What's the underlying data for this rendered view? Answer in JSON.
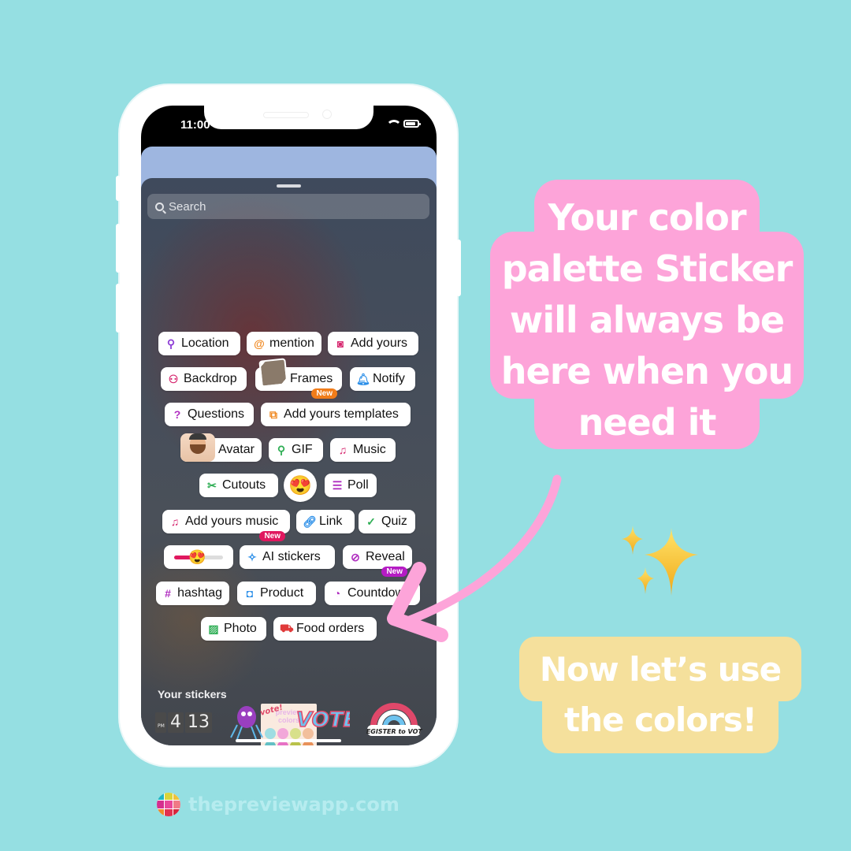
{
  "status_bar": {
    "time": "11:00"
  },
  "sticker_sheet": {
    "search": {
      "placeholder": "Search",
      "value": ""
    },
    "chips": [
      {
        "id": "location",
        "label": "Location",
        "icon": "location-pin-icon",
        "glyph": "⚲",
        "icon_color": "#8e3fd6"
      },
      {
        "id": "mention",
        "label": "mention",
        "icon": "threads-at-icon",
        "glyph": "@",
        "icon_color": "#f08a24"
      },
      {
        "id": "add-yours",
        "label": "Add yours",
        "icon": "camera-icon",
        "glyph": "◙",
        "icon_color": "#d6266e"
      },
      {
        "id": "backdrop",
        "label": "Backdrop",
        "icon": "backdrop-person-icon",
        "glyph": "⚇",
        "icon_color": "#d6266e"
      },
      {
        "id": "frames",
        "label": "Frames",
        "icon": "photo-frame-thumbnail",
        "badge": "New",
        "badge_color": "#f07c1a"
      },
      {
        "id": "notify",
        "label": "Notify",
        "icon": "bell-icon",
        "glyph": "🔔︎",
        "icon_color": "#2a8ee8"
      },
      {
        "id": "questions",
        "label": "Questions",
        "icon": "question-bubble-icon",
        "glyph": "?",
        "icon_color": "#b02fc0"
      },
      {
        "id": "add-yours-templates",
        "label": "Add yours templates",
        "icon": "add-layers-icon",
        "glyph": "⧉",
        "icon_color": "#f08a24"
      },
      {
        "id": "avatar",
        "label": "Avatar",
        "icon": "avatar-thumbnail"
      },
      {
        "id": "gif",
        "label": "GIF",
        "icon": "search-icon",
        "glyph": "⚲",
        "icon_color": "#2fae55"
      },
      {
        "id": "music",
        "label": "Music",
        "icon": "music-note-icon",
        "glyph": "♫",
        "icon_color": "#d6266e"
      },
      {
        "id": "cutouts",
        "label": "Cutouts",
        "icon": "scissors-icon",
        "glyph": "✂",
        "icon_color": "#2fae55"
      },
      {
        "id": "emoji",
        "label": "",
        "icon": "heart-eyes-emoji",
        "glyph": "😍"
      },
      {
        "id": "poll",
        "label": "Poll",
        "icon": "poll-bars-icon",
        "glyph": "☰",
        "icon_color": "#b02fc0"
      },
      {
        "id": "add-yours-music",
        "label": "Add yours music",
        "icon": "music-plus-icon",
        "glyph": "♫",
        "icon_color": "#d6266e",
        "badge": "New",
        "badge_color": "#e0185f"
      },
      {
        "id": "link",
        "label": "Link",
        "icon": "link-icon",
        "glyph": "🔗︎",
        "icon_color": "#2a8ee8"
      },
      {
        "id": "quiz",
        "label": "Quiz",
        "icon": "check-circle-icon",
        "glyph": "✓",
        "icon_color": "#2fae55"
      },
      {
        "id": "emoji-slider",
        "label": "",
        "icon": "emoji-slider",
        "glyph": "😍",
        "slider_value": 0.45
      },
      {
        "id": "ai-stickers",
        "label": "AI stickers",
        "icon": "sparkle-shapes-icon",
        "glyph": "✧",
        "icon_color": "#2a8ee8"
      },
      {
        "id": "reveal",
        "label": "Reveal",
        "icon": "eye-off-icon",
        "glyph": "⊘",
        "icon_color": "#b02fc0",
        "badge": "New",
        "badge_color": "#b51bc4"
      },
      {
        "id": "hashtag",
        "label": "hashtag",
        "icon": "hashtag-icon",
        "glyph": "#",
        "icon_color": "#b02fc0"
      },
      {
        "id": "product",
        "label": "Product",
        "icon": "shopping-bag-icon",
        "glyph": "◘",
        "icon_color": "#2a8ee8"
      },
      {
        "id": "countdown",
        "label": "Countdown",
        "icon": "countdown-timer-icon",
        "glyph": "◔",
        "icon_color": "#b02fc0"
      },
      {
        "id": "photo",
        "label": "Photo",
        "icon": "image-icon",
        "glyph": "▨",
        "icon_color": "#2fae55"
      },
      {
        "id": "food-orders",
        "label": "Food orders",
        "icon": "delivery-truck-icon",
        "glyph": "⛟",
        "icon_color": "#e03a3a"
      }
    ],
    "your_stickers": {
      "heading": "Your stickers",
      "palette_sticker": {
        "title_line1": "preview",
        "title_line2": "colors",
        "colors": [
          "#9fdde2",
          "#f2a7d9",
          "#d8e08a",
          "#f2bf9c",
          "#63bfc4",
          "#e772c5",
          "#b9c24a",
          "#e8915a"
        ]
      }
    },
    "tray": {
      "clock_digits": [
        "4",
        "13"
      ],
      "clock_small_label": "PM",
      "stickers": [
        {
          "name": "spider-vote-sticker",
          "text": "vote!"
        },
        {
          "name": "vote-sticker",
          "text": "VOTE"
        },
        {
          "name": "register-to-vote-sticker",
          "text": "REGISTER to VOTE"
        }
      ]
    }
  },
  "callouts": {
    "pink": {
      "lines": [
        "Your color",
        "palette Sticker",
        "will always be",
        "here when you",
        "need it"
      ],
      "bg_color": "#fda4d9"
    },
    "yellow": {
      "lines": [
        "Now let’s use",
        "the colors!"
      ],
      "bg_color": "#f5e09c"
    },
    "sparkles_emoji": "✨"
  },
  "brand": {
    "text": "thepreviewapp.com",
    "logo_colors": [
      "#1fb5c4",
      "#d9d43a",
      "#f0c23a",
      "#d52f8f",
      "#e8489a",
      "#f07a86",
      "#f08a2a",
      "#e3304f",
      "#d8243c"
    ]
  },
  "background_color": "#95dfe2"
}
